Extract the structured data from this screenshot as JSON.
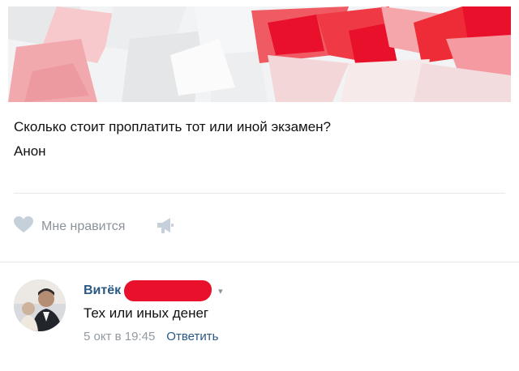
{
  "post": {
    "text_line1": "Сколько стоит проплатить тот или иной экзамен?",
    "text_line2": "Анон"
  },
  "actions": {
    "like_label": "Мне нравится"
  },
  "comment": {
    "author": "Витёк",
    "text": "Тех или иных денег",
    "date": "5 окт в 19:45",
    "reply_label": "Ответить"
  },
  "colors": {
    "link": "#2a5885",
    "muted": "#939aa1",
    "accent_red": "#e8102a",
    "divider": "#e3e6ea"
  },
  "icons": [
    "heart-icon",
    "megaphone-icon",
    "chevron-down-icon"
  ]
}
